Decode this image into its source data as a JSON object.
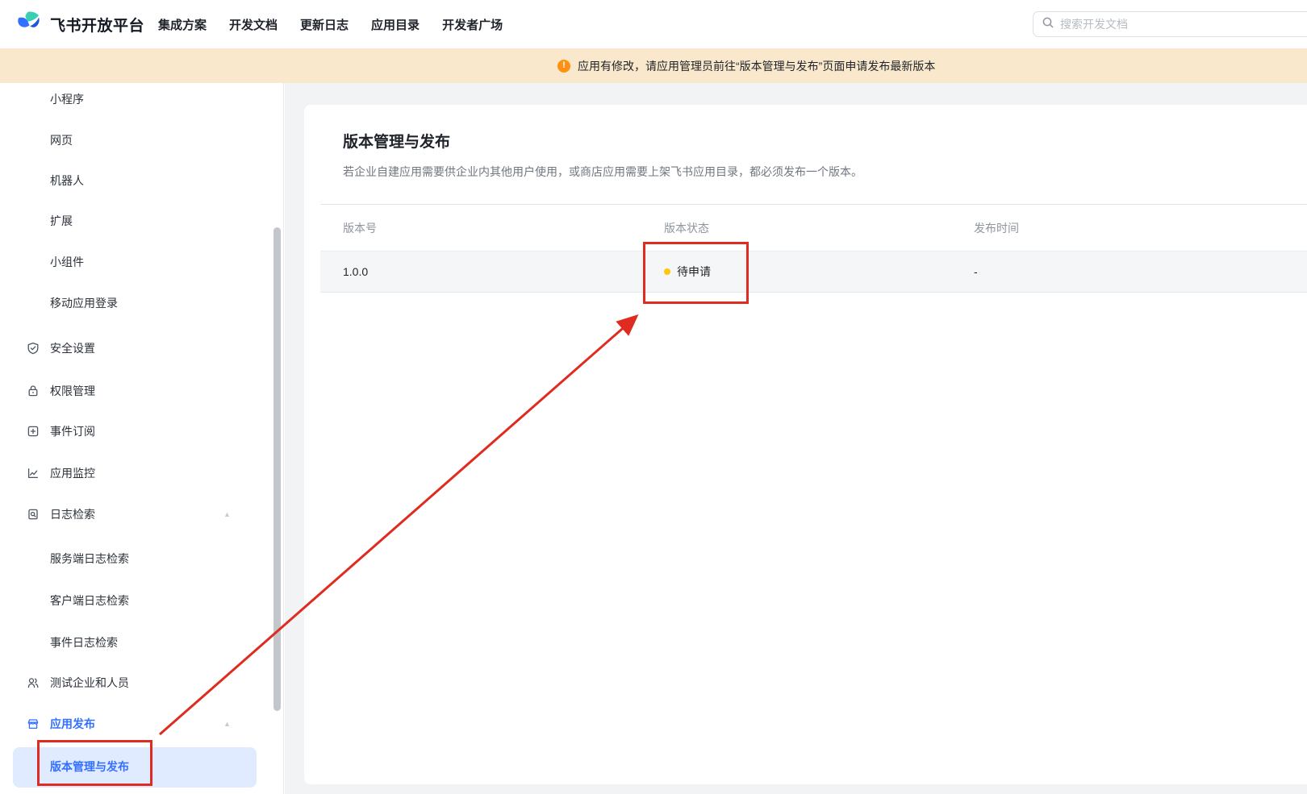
{
  "nav": {
    "logo_text": "飞书开放平台",
    "menu": [
      "集成方案",
      "开发文档",
      "更新日志",
      "应用目录",
      "开发者广场"
    ],
    "search_placeholder": "搜索开发文档"
  },
  "banner": {
    "text": "应用有修改，请应用管理员前往“版本管理与发布”页面申请发布最新版本"
  },
  "sidebar": {
    "items": [
      {
        "label": "小程序",
        "type": "sub"
      },
      {
        "label": "网页",
        "type": "sub"
      },
      {
        "label": "机器人",
        "type": "sub"
      },
      {
        "label": "扩展",
        "type": "sub"
      },
      {
        "label": "小组件",
        "type": "sub"
      },
      {
        "label": "移动应用登录",
        "type": "sub"
      },
      {
        "label": "安全设置",
        "type": "group",
        "icon": "shield-icon"
      },
      {
        "label": "权限管理",
        "type": "group",
        "icon": "lock-icon"
      },
      {
        "label": "事件订阅",
        "type": "group",
        "icon": "event-subscribe-icon"
      },
      {
        "label": "应用监控",
        "type": "group",
        "icon": "monitor-chart-icon"
      },
      {
        "label": "日志检索",
        "type": "group",
        "icon": "log-search-icon",
        "expandable": true
      },
      {
        "label": "服务端日志检索",
        "type": "sub"
      },
      {
        "label": "客户端日志检索",
        "type": "sub"
      },
      {
        "label": "事件日志检索",
        "type": "sub"
      },
      {
        "label": "测试企业和人员",
        "type": "group",
        "icon": "people-icon"
      },
      {
        "label": "应用发布",
        "type": "group",
        "icon": "store-release-icon",
        "expandable": true,
        "active": true
      },
      {
        "label": "版本管理与发布",
        "type": "sub",
        "selected": true
      }
    ]
  },
  "main": {
    "title": "版本管理与发布",
    "description": "若企业自建应用需要供企业内其他用户使用，或商店应用需要上架飞书应用目录，都必须发布一个版本。",
    "table": {
      "columns": [
        "版本号",
        "版本状态",
        "发布时间"
      ],
      "rows": [
        {
          "version": "1.0.0",
          "status": "待申请",
          "publish_time": "-"
        }
      ]
    }
  },
  "colors": {
    "accent_blue": "#3370ff",
    "selected_bg": "#e1ebff",
    "banner_bg": "#f9e8cc",
    "warning_orange": "#fe9113",
    "status_yellow": "#ffc60a",
    "annotation_red": "#df2b20",
    "row_bg": "#f5f6f8"
  }
}
